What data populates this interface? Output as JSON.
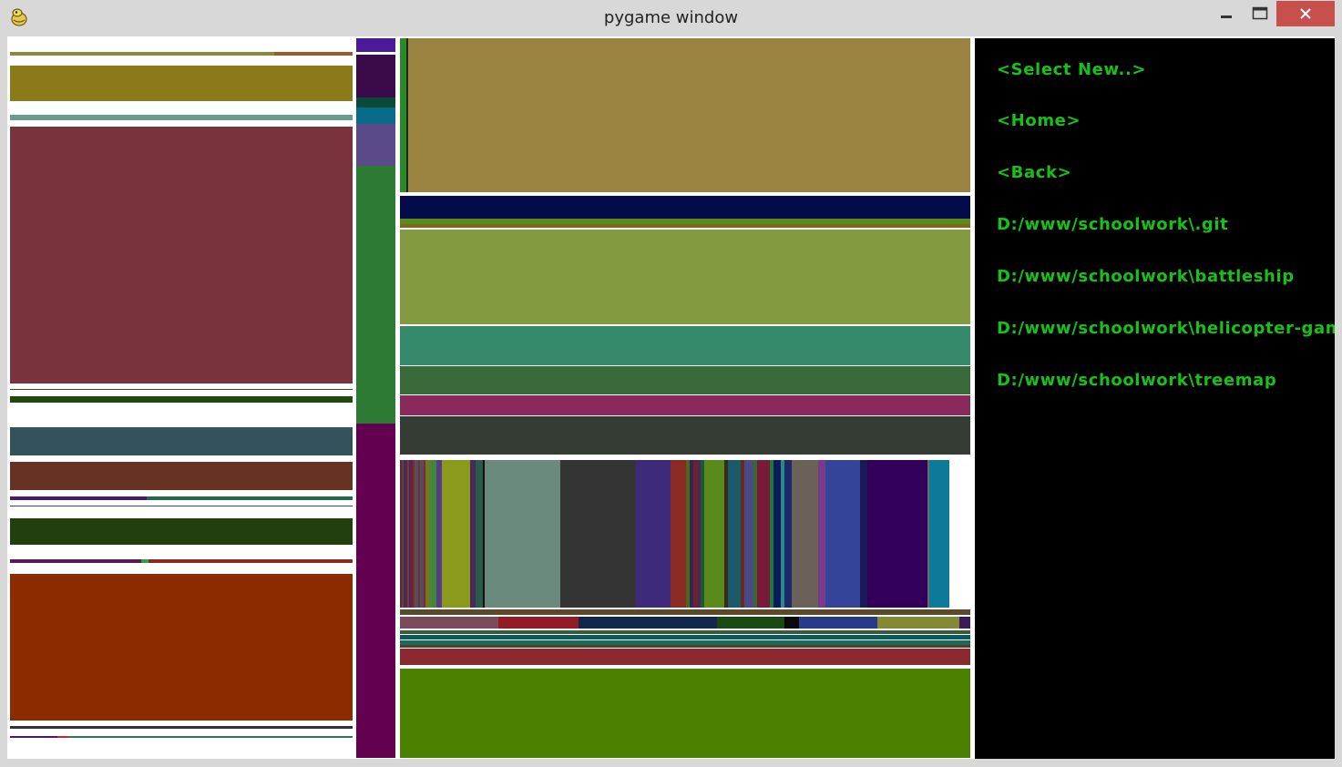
{
  "window": {
    "title": "pygame window",
    "icon": "pygame-snake-icon",
    "controls": [
      "minimize-icon",
      "maximize-icon",
      "close-icon"
    ]
  },
  "sidebar": {
    "text_color": "#16c216",
    "background": "#000000",
    "items": [
      {
        "label": "<Select New..>"
      },
      {
        "label": "<Home>"
      },
      {
        "label": "<Back>"
      },
      {
        "label": "D:/www/schoolwork\\.git"
      },
      {
        "label": "D:/www/schoolwork\\battleship"
      },
      {
        "label": "D:/www/schoolwork\\helicopter-game"
      },
      {
        "label": "D:/www/schoolwork\\treemap"
      }
    ]
  }
}
